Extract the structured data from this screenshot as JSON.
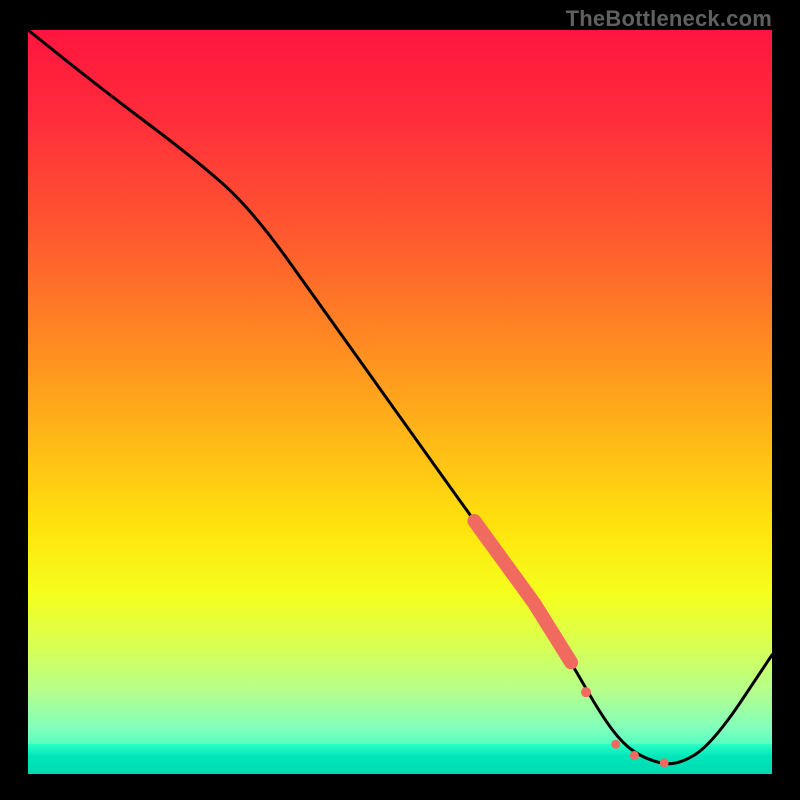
{
  "attribution": "TheBottleneck.com",
  "chart_data": {
    "type": "line",
    "title": "",
    "xlabel": "",
    "ylabel": "",
    "xlim": [
      0,
      100
    ],
    "ylim": [
      0,
      100
    ],
    "grid": false,
    "legend": false,
    "series": [
      {
        "name": "bottleneck-curve",
        "color": "#000000",
        "x": [
          0,
          10,
          22,
          30,
          40,
          50,
          60,
          68,
          73,
          77,
          80,
          83,
          87,
          92,
          100
        ],
        "values": [
          100,
          92,
          83,
          76,
          62,
          48,
          34,
          23,
          15,
          8,
          4,
          2,
          1,
          4,
          16
        ]
      }
    ],
    "markers": [
      {
        "name": "thick-segment",
        "type": "line-highlight",
        "color": "#f06a60",
        "x": [
          60,
          68,
          73
        ],
        "values": [
          34,
          23,
          15
        ],
        "weight": 14
      },
      {
        "name": "dot-1",
        "type": "point",
        "color": "#f06a60",
        "x": 75,
        "value": 11,
        "size": 10
      },
      {
        "name": "dot-cluster-a",
        "type": "point",
        "color": "#f06a60",
        "x": 79,
        "value": 4,
        "size": 9
      },
      {
        "name": "dot-cluster-b",
        "type": "point",
        "color": "#f06a60",
        "x": 81.5,
        "value": 2.5,
        "size": 9
      },
      {
        "name": "dot-right",
        "type": "point",
        "color": "#f06a60",
        "x": 85.5,
        "value": 1.5,
        "size": 9
      }
    ],
    "gradient_stops": [
      {
        "pos": 0,
        "color": "#ff153f"
      },
      {
        "pos": 12,
        "color": "#ff2d3b"
      },
      {
        "pos": 28,
        "color": "#ff5a2f"
      },
      {
        "pos": 42,
        "color": "#ff8a22"
      },
      {
        "pos": 55,
        "color": "#ffb817"
      },
      {
        "pos": 67,
        "color": "#ffe40c"
      },
      {
        "pos": 76,
        "color": "#f4ff1e"
      },
      {
        "pos": 83,
        "color": "#d8ff55"
      },
      {
        "pos": 89,
        "color": "#b4ff8d"
      },
      {
        "pos": 94,
        "color": "#7fffbd"
      },
      {
        "pos": 98,
        "color": "#2effc5"
      },
      {
        "pos": 100,
        "color": "#00f5c0"
      }
    ]
  }
}
